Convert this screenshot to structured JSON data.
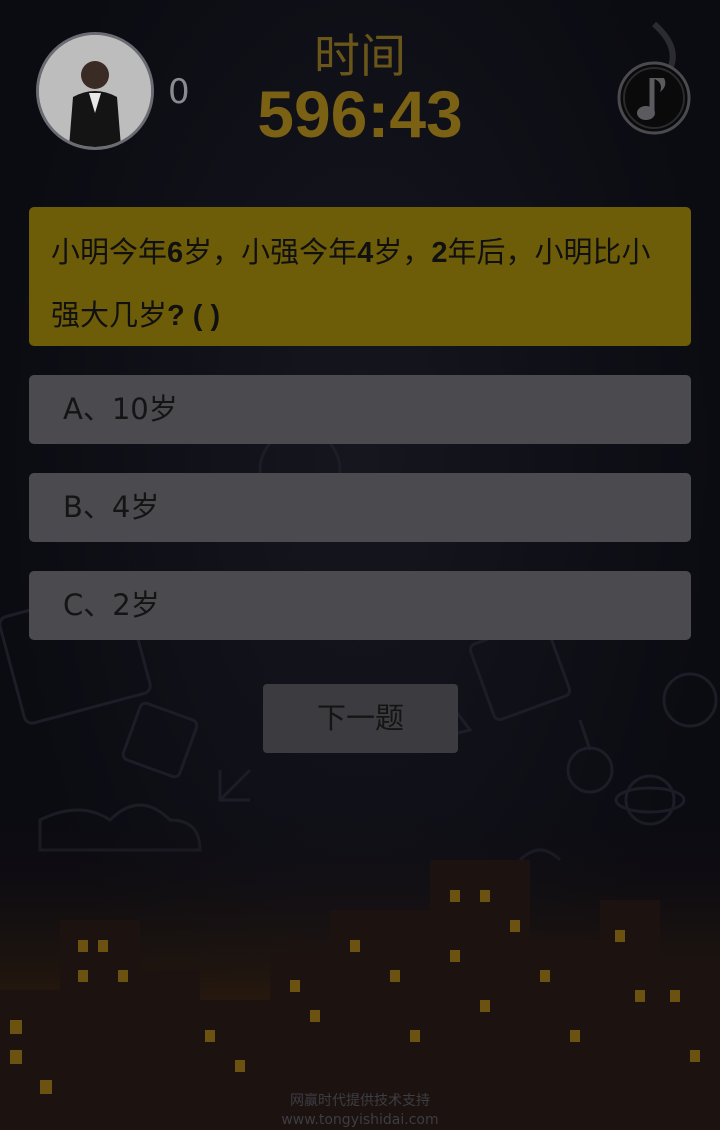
{
  "header": {
    "score": "0",
    "timer_label": "时间",
    "timer_value": "596:43"
  },
  "question": {
    "parts": [
      "小明今年",
      "6",
      "岁，小强今年",
      "4",
      "岁，",
      "2",
      "年后，小明比小强大几岁",
      "?",
      " ( )"
    ]
  },
  "options": [
    {
      "label": "A、10岁"
    },
    {
      "label": "B、4岁"
    },
    {
      "label": "C、2岁"
    }
  ],
  "next_button": {
    "label": "下一题"
  },
  "footer": {
    "line1": "网赢时代提供技术支持",
    "line2": "www.tongyishidai.com"
  },
  "icons": {
    "music": "music-note-icon",
    "avatar": "avatar-photo"
  },
  "colors": {
    "background": "#0b0b12",
    "timer": "#7a6114",
    "question_bg": "#6e5d08",
    "option_bg": "#4a4a4f"
  }
}
